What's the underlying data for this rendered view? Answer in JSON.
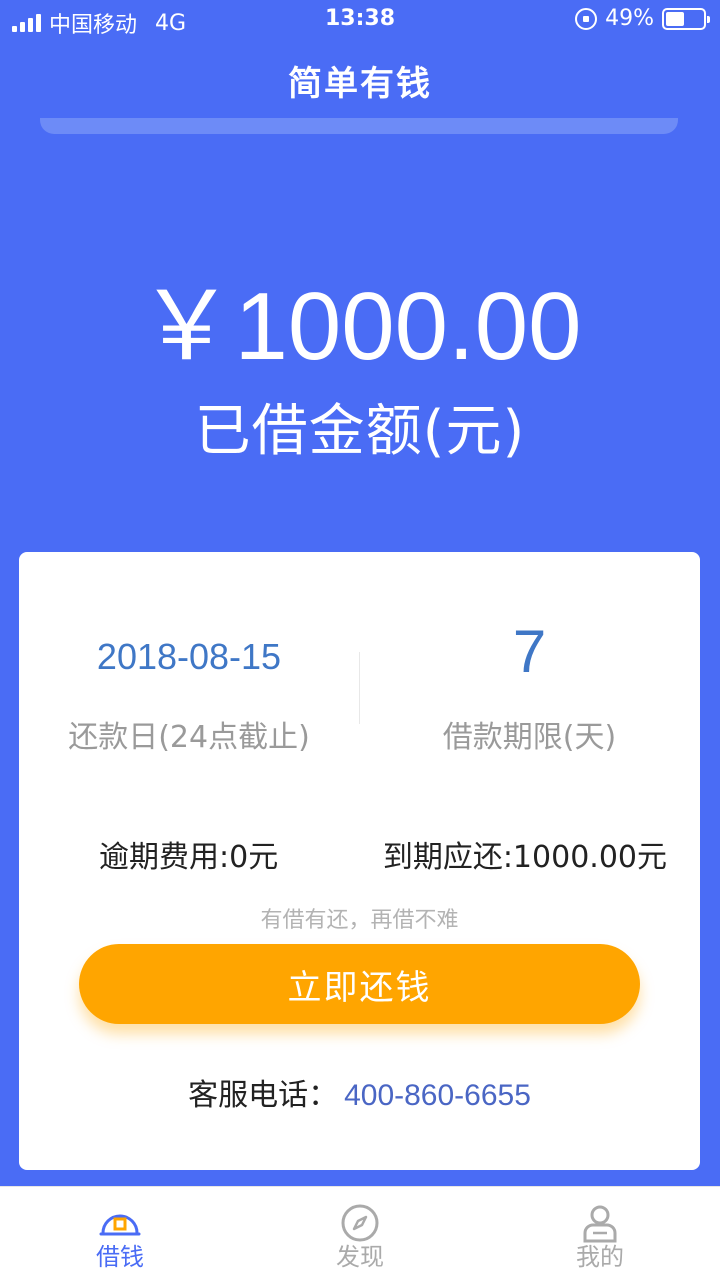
{
  "status_bar": {
    "carrier": "中国移动",
    "network": "4G",
    "time": "13:38",
    "battery": "49%",
    "battery_level": 0.49
  },
  "nav": {
    "title": "简单有钱"
  },
  "loan": {
    "amount": "￥1000.00",
    "amount_label": "已借金额(元)"
  },
  "card": {
    "due_date": "2018-08-15",
    "due_date_label": "还款日(24点截止)",
    "term_days": "7",
    "term_label": "借款期限(天)",
    "overdue_fee": "逾期费用:0元",
    "due_total": "到期应还:1000.00元",
    "slogan": "有借有还，再借不难",
    "repay_button": "立即还钱",
    "service_label": "客服电话：",
    "service_phone": "400-860-6655"
  },
  "tabs": [
    {
      "label": "借钱",
      "icon": "loan-icon",
      "active": true
    },
    {
      "label": "发现",
      "icon": "compass-icon",
      "active": false
    },
    {
      "label": "我的",
      "icon": "profile-icon",
      "active": false
    }
  ],
  "colors": {
    "brand": "#4a6cf5",
    "button": "#ffa500",
    "accent_text": "#3f77c6"
  }
}
